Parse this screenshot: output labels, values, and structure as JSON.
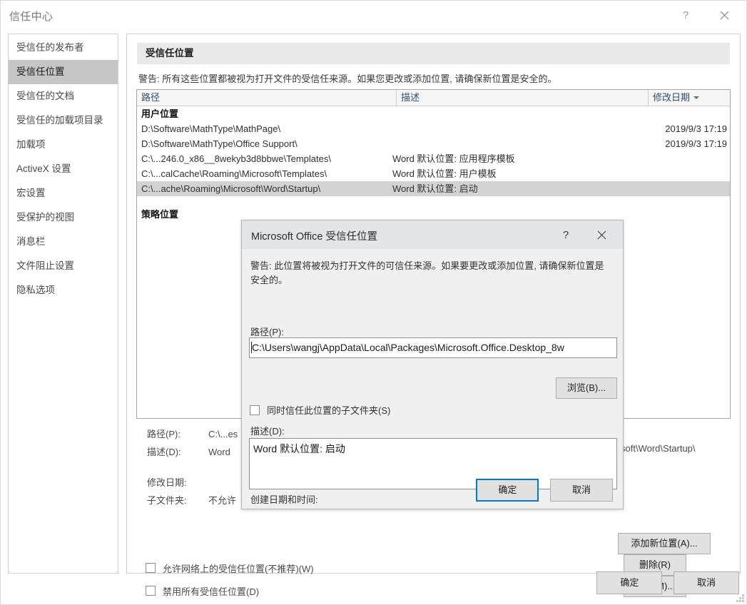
{
  "window": {
    "title": "信任中心",
    "help_icon": "question-mark-icon",
    "close_icon": "close-icon"
  },
  "sidebar": {
    "items": [
      {
        "label": "受信任的发布者",
        "selected": false
      },
      {
        "label": "受信任位置",
        "selected": true
      },
      {
        "label": "受信任的文档",
        "selected": false
      },
      {
        "label": "受信任的加载项目录",
        "selected": false
      },
      {
        "label": "加载项",
        "selected": false
      },
      {
        "label": "ActiveX 设置",
        "selected": false
      },
      {
        "label": "宏设置",
        "selected": false
      },
      {
        "label": "受保护的视图",
        "selected": false
      },
      {
        "label": "消息栏",
        "selected": false
      },
      {
        "label": "文件阻止设置",
        "selected": false
      },
      {
        "label": "隐私选项",
        "selected": false
      }
    ]
  },
  "main": {
    "section_title": "受信任位置",
    "warning": "警告: 所有这些位置都被视为打开文件的受信任来源。如果您更改或添加位置, 请确保新位置是安全的。",
    "table": {
      "columns": [
        "路径",
        "描述",
        "修改日期"
      ],
      "sort_column": "修改日期",
      "sort_direction": "descending",
      "groups": [
        {
          "name": "用户位置",
          "rows": [
            {
              "path": "D:\\Software\\MathType\\MathPage\\",
              "description": "",
              "modified": "2019/9/3 17:19",
              "selected": false
            },
            {
              "path": "D:\\Software\\MathType\\Office Support\\",
              "description": "",
              "modified": "2019/9/3 17:19",
              "selected": false
            },
            {
              "path": "C:\\...246.0_x86__8wekyb3d8bbwe\\Templates\\",
              "description": "Word 默认位置: 应用程序模板",
              "modified": "",
              "selected": false
            },
            {
              "path": "C:\\...calCache\\Roaming\\Microsoft\\Templates\\",
              "description": "Word 默认位置: 用户模板",
              "modified": "",
              "selected": false
            },
            {
              "path": "C:\\...ache\\Roaming\\Microsoft\\Word\\Startup\\",
              "description": "Word 默认位置: 启动",
              "modified": "",
              "selected": true
            }
          ]
        },
        {
          "name": "策略位置",
          "rows": []
        }
      ]
    },
    "details": {
      "path_label": "路径(P):",
      "path_value": "C:\\...es",
      "path_value_tail": "soft\\Word\\Startup\\",
      "desc_label": "描述(D):",
      "desc_value": "Word",
      "modified_label": "修改日期:",
      "modified_value": "",
      "subfolder_label": "子文件夹:",
      "subfolder_value": "不允许"
    },
    "action_buttons": [
      {
        "label": "添加新位置(A)...",
        "name": "add-location-button"
      },
      {
        "label": "删除(R)",
        "name": "remove-button"
      },
      {
        "label": "修改(M)...",
        "name": "modify-button"
      }
    ],
    "checkboxes": [
      {
        "label": "允许网络上的受信任位置(不推荐)(W)",
        "checked": false
      },
      {
        "label": "禁用所有受信任位置(D)",
        "checked": false
      }
    ]
  },
  "footer": {
    "ok": "确定",
    "cancel": "取消"
  },
  "dialog": {
    "title": "Microsoft Office 受信任位置",
    "help_icon": "question-mark-icon",
    "close_icon": "close-icon",
    "warning": "警告: 此位置将被视为打开文件的可信任来源。如果要更改或添加位置, 请确保新位置是安全的。",
    "path_label": "路径(P):",
    "path_value": "C:\\Users\\wangj\\AppData\\Local\\Packages\\Microsoft.Office.Desktop_8w",
    "browse_button": "浏览(B)...",
    "subfolder_checkbox": {
      "label": "同时信任此位置的子文件夹(S)",
      "checked": false
    },
    "desc_label": "描述(D):",
    "desc_value": "Word 默认位置: 启动",
    "created_label": "创建日期和时间:",
    "created_value": "",
    "ok": "确定",
    "cancel": "取消"
  },
  "colors": {
    "accent": "#0078d7",
    "selected_row": "#d3d3d3",
    "sidebar_selected": "#c6c6c6",
    "section_header": "#e9e9e9",
    "dialog_bg": "#f0f0f0",
    "dialog_titlebar": "#e3e6e8"
  }
}
